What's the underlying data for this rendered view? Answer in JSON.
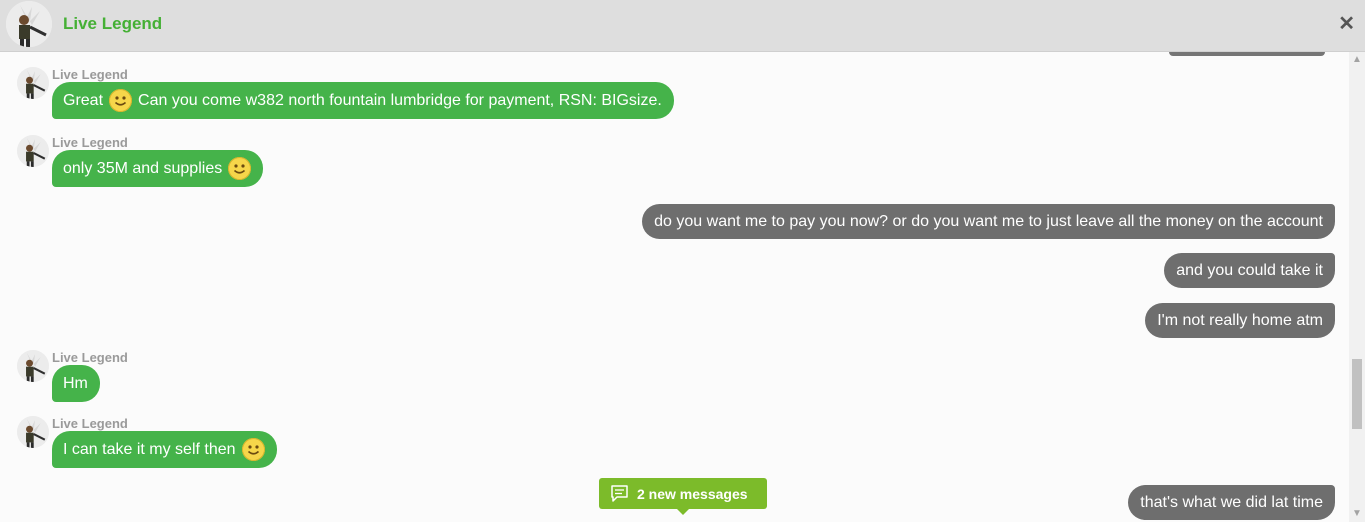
{
  "header": {
    "title": "Live Legend",
    "close_icon": "close-icon"
  },
  "colors": {
    "accent_green": "#45b34a",
    "outgoing_gray": "#6e6e6e",
    "badge_green": "#7cbb2a"
  },
  "messages": [
    {
      "direction": "in",
      "sender": "Live Legend",
      "text_before": "Great",
      "emoji": "smiley",
      "text_after": "Can you come w382 north fountain lumbridge for payment, RSN: BIGsize."
    },
    {
      "direction": "in",
      "sender": "Live Legend",
      "text_before": "only 35M and supplies",
      "emoji": "smiley",
      "text_after": ""
    },
    {
      "direction": "out",
      "text": "do you want me to pay you now? or do you want me to just leave all the money on the account"
    },
    {
      "direction": "out",
      "text": "and you could take it"
    },
    {
      "direction": "out",
      "text": "I'm not really home atm"
    },
    {
      "direction": "in",
      "sender": "Live Legend",
      "text_before": "Hm",
      "emoji": "",
      "text_after": ""
    },
    {
      "direction": "in",
      "sender": "Live Legend",
      "text_before": "I can take it my self then",
      "emoji": "smiley",
      "text_after": ""
    },
    {
      "direction": "out",
      "text": "that's what we did lat time"
    }
  ],
  "new_messages_badge": {
    "label": "2 new messages",
    "icon": "message-icon"
  }
}
